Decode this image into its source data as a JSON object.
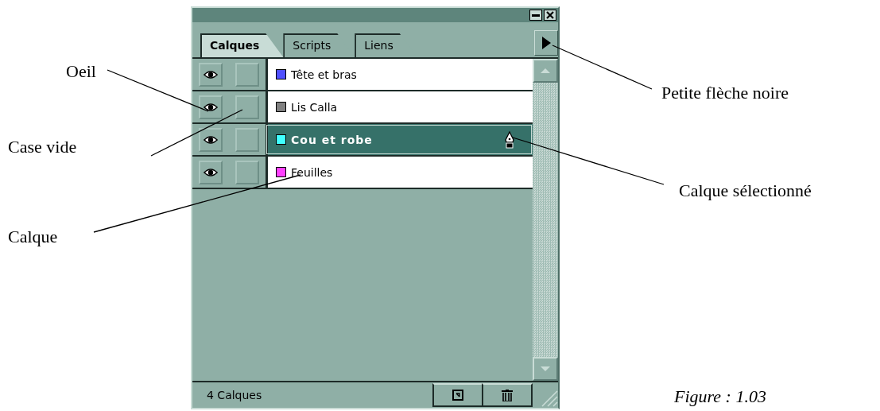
{
  "palette": {
    "tabs": [
      {
        "label": "Calques",
        "selected": true
      },
      {
        "label": "Scripts",
        "selected": false
      },
      {
        "label": "Liens",
        "selected": false
      }
    ],
    "layers": [
      {
        "name": "Tête et bras",
        "color": "#5050ff",
        "visible": true,
        "selected": false
      },
      {
        "name": "Lis Calla",
        "color": "#808080",
        "visible": true,
        "selected": false
      },
      {
        "name": "Cou et robe",
        "color": "#40ffff",
        "visible": true,
        "selected": true
      },
      {
        "name": "Feuilles",
        "color": "#ff40ff",
        "visible": true,
        "selected": false
      }
    ],
    "status_bar": "4 Calques"
  },
  "annotations": [
    {
      "label": "Oeil"
    },
    {
      "label": "Case vide"
    },
    {
      "label": "Calque"
    },
    {
      "label": "Petite flèche noire"
    },
    {
      "label": "Calque sélectionné"
    }
  ],
  "caption": "Figure : 1.03"
}
